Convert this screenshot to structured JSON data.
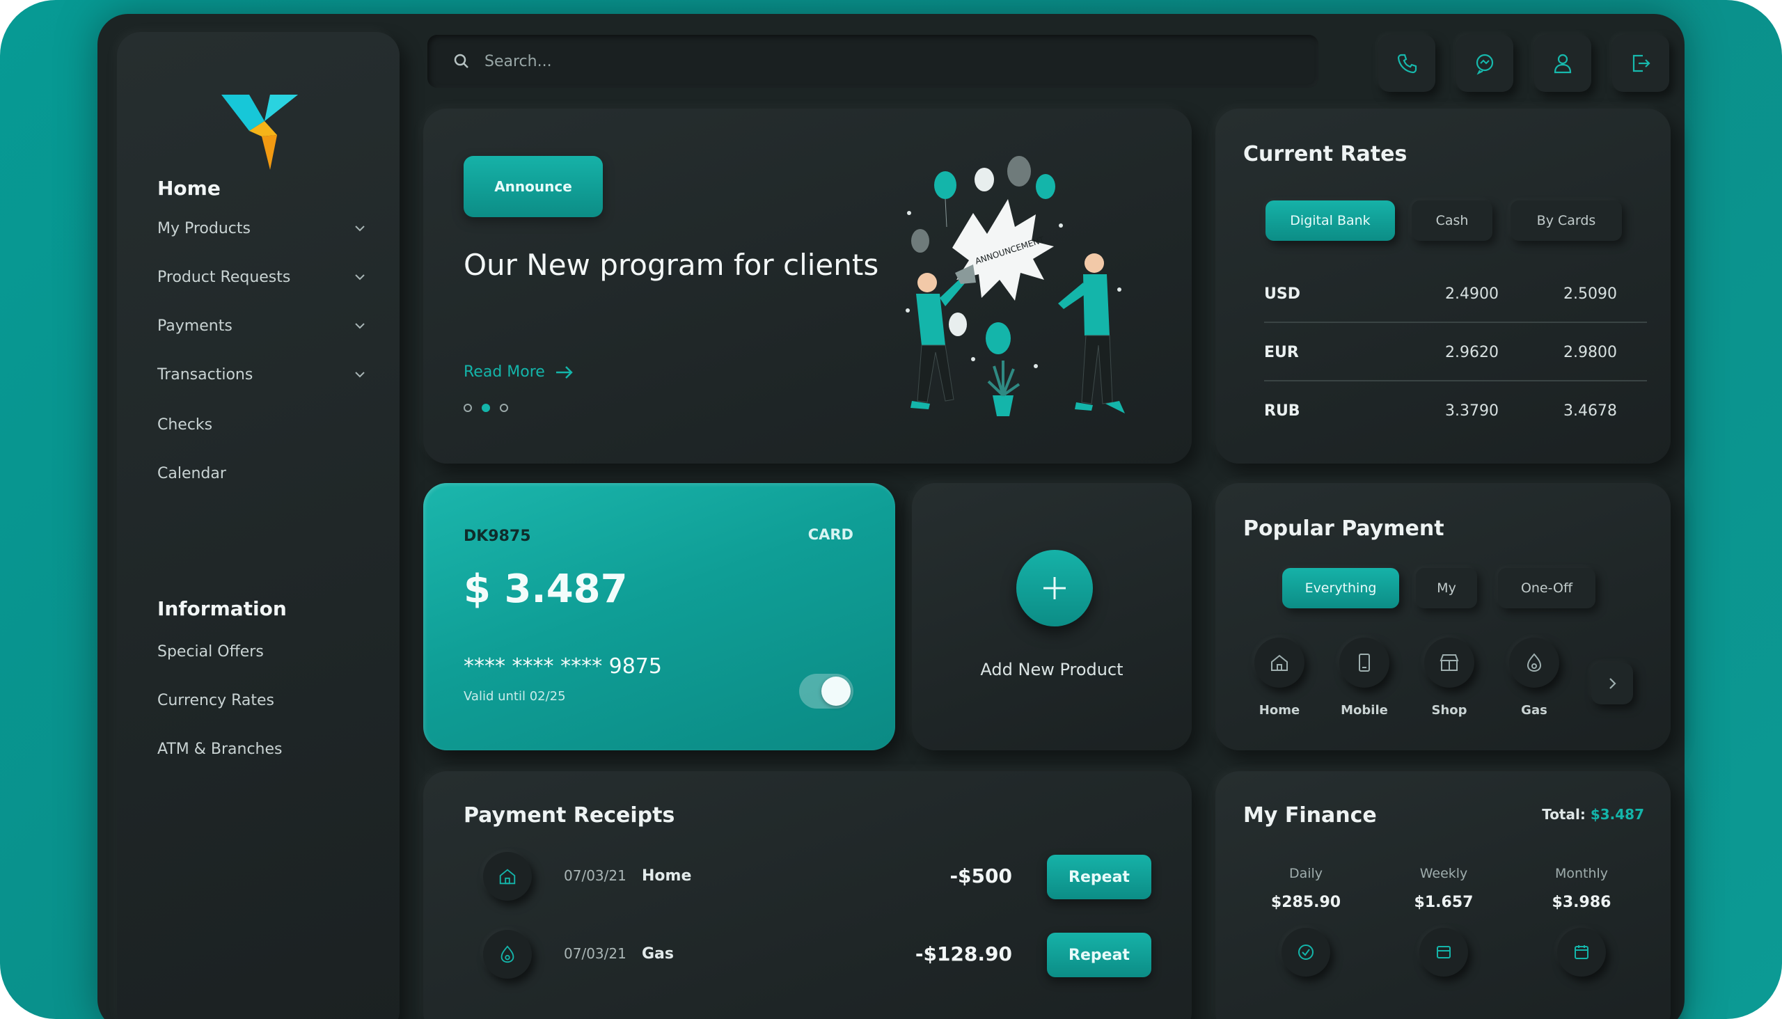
{
  "search": {
    "placeholder": "Search..."
  },
  "topbar": {
    "icons": [
      "phone-icon",
      "chat-icon",
      "user-icon",
      "logout-icon"
    ]
  },
  "sidebar": {
    "section1_title": "Home",
    "items": [
      {
        "label": "My Products",
        "chevron": true
      },
      {
        "label": "Product Requests",
        "chevron": true
      },
      {
        "label": "Payments",
        "chevron": true
      },
      {
        "label": "Transactions",
        "chevron": true
      },
      {
        "label": "Checks",
        "chevron": false
      },
      {
        "label": "Calendar",
        "chevron": false
      }
    ],
    "section2_title": "Information",
    "info_items": [
      {
        "label": "Special Offers"
      },
      {
        "label": "Currency Rates"
      },
      {
        "label": "ATM & Branches"
      }
    ]
  },
  "announce": {
    "badge": "Announce",
    "title": "Our New program for clients",
    "read_more": "Read More",
    "carousel_active_index": 1,
    "carousel_count": 3,
    "illustration_text": "ANNOUNCEMENT"
  },
  "rates": {
    "title": "Current Rates",
    "tabs": [
      "Digital Bank",
      "Cash",
      "By Cards"
    ],
    "active_tab": 0,
    "rows": [
      {
        "currency": "USD",
        "buy": "2.4900",
        "sell": "2.5090"
      },
      {
        "currency": "EUR",
        "buy": "2.9620",
        "sell": "2.9800"
      },
      {
        "currency": "RUB",
        "buy": "3.3790",
        "sell": "3.4678"
      }
    ]
  },
  "card": {
    "id": "DK9875",
    "type": "CARD",
    "amount": "$ 3.487",
    "number": "**** **** **** 9875",
    "valid": "Valid until 02/25",
    "toggle_on": true
  },
  "add_product": {
    "label": "Add New Product"
  },
  "popular": {
    "title": "Popular Payment",
    "tabs": [
      "Everything",
      "My",
      "One-Off"
    ],
    "active_tab": 0,
    "items": [
      {
        "label": "Home",
        "icon": "home-icon"
      },
      {
        "label": "Mobile",
        "icon": "mobile-icon"
      },
      {
        "label": "Shop",
        "icon": "shop-icon"
      },
      {
        "label": "Gas",
        "icon": "gas-icon"
      }
    ]
  },
  "receipts": {
    "title": "Payment Receipts",
    "rows": [
      {
        "date": "07/03/21",
        "name": "Home",
        "amount": "-$500",
        "action": "Repeat",
        "icon": "home-icon"
      },
      {
        "date": "07/03/21",
        "name": "Gas",
        "amount": "-$128.90",
        "action": "Repeat",
        "icon": "gas-icon"
      }
    ]
  },
  "finance": {
    "title": "My Finance",
    "total_label": "Total:",
    "total_value": "$3.487",
    "columns": [
      {
        "label": "Daily",
        "value": "$285.90"
      },
      {
        "label": "Weekly",
        "value": "$1.657"
      },
      {
        "label": "Monthly",
        "value": "$3.986"
      }
    ]
  },
  "colors": {
    "accent": "#14b5aa",
    "panel": "#242b2c",
    "background": "#0a908a"
  }
}
